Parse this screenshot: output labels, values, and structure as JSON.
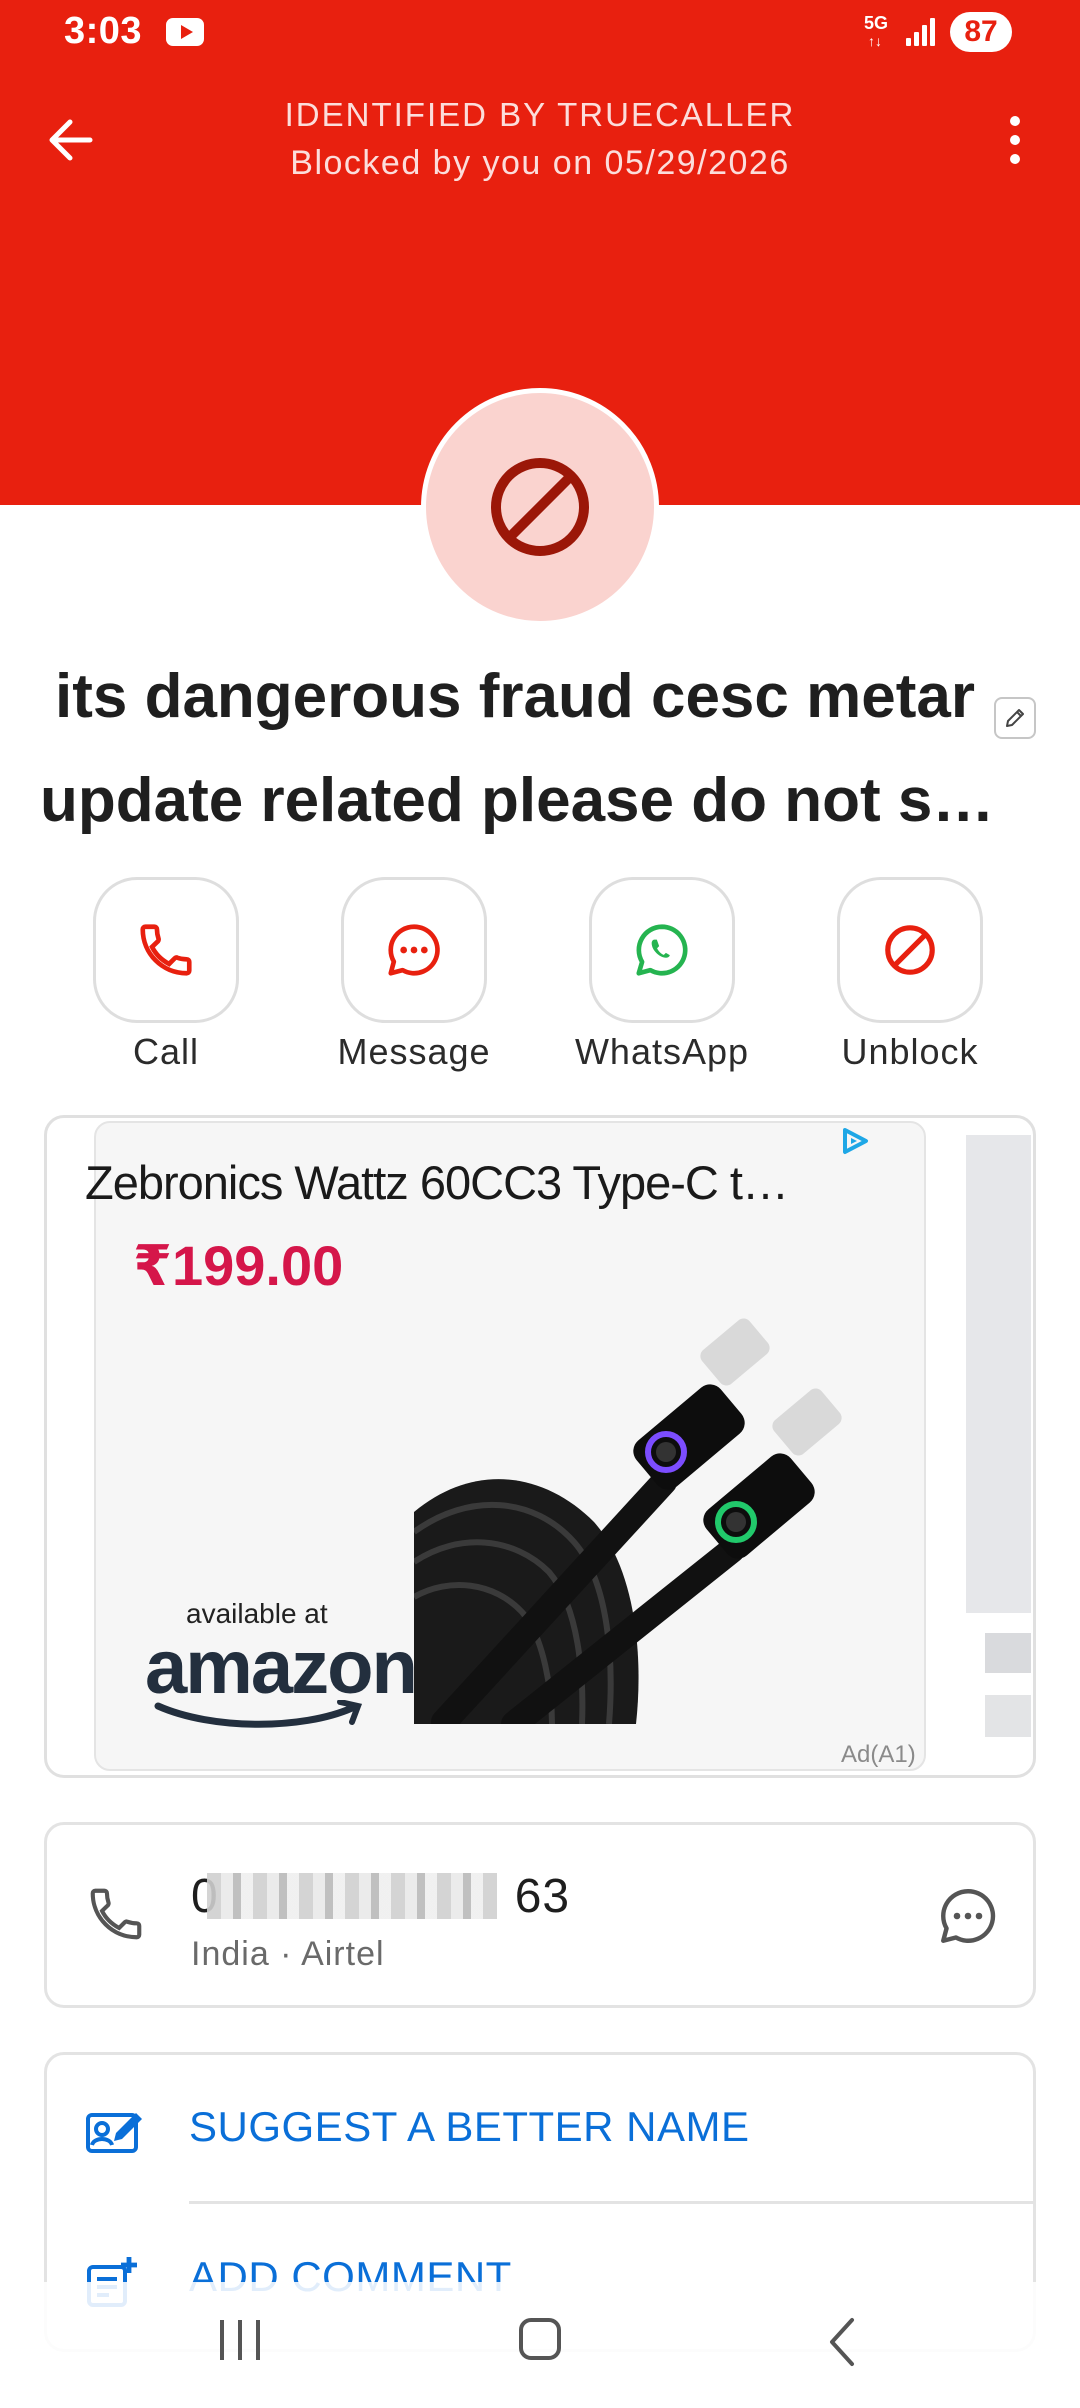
{
  "status_bar": {
    "time": "3:03",
    "network": "5G",
    "battery": "87"
  },
  "header": {
    "title": "IDENTIFIED BY TRUECALLER",
    "subtitle": "Blocked by you on 05/29/2026",
    "color": "#e8200f"
  },
  "contact": {
    "name_line1": "its dangerous fraud cesc metar",
    "name_line2": "update related please do not s…"
  },
  "actions": [
    {
      "label": "Call",
      "icon": "phone-icon",
      "color": "#e8200f"
    },
    {
      "label": "Message",
      "icon": "chat-icon",
      "color": "#e8200f"
    },
    {
      "label": "WhatsApp",
      "icon": "whatsapp-icon",
      "color": "#25b450"
    },
    {
      "label": "Unblock",
      "icon": "block-icon",
      "color": "#e8200f"
    }
  ],
  "ad": {
    "title": "Zebronics Wattz 60CC3 Type-C t…",
    "price": "₹199.00",
    "available_at": "available at",
    "brand": "amazon",
    "label": "Ad(A1)"
  },
  "number": {
    "value_prefix": "0",
    "value_suffix": "63",
    "location": "India · Airtel"
  },
  "options": [
    {
      "label": "SUGGEST A BETTER NAME",
      "icon": "suggest-name-icon"
    },
    {
      "label": "ADD COMMENT",
      "icon": "add-comment-icon"
    }
  ],
  "colors": {
    "accent_red": "#e8200f",
    "link_blue": "#0a6fd8",
    "price_red": "#d5164a",
    "whatsapp_green": "#25b450"
  }
}
